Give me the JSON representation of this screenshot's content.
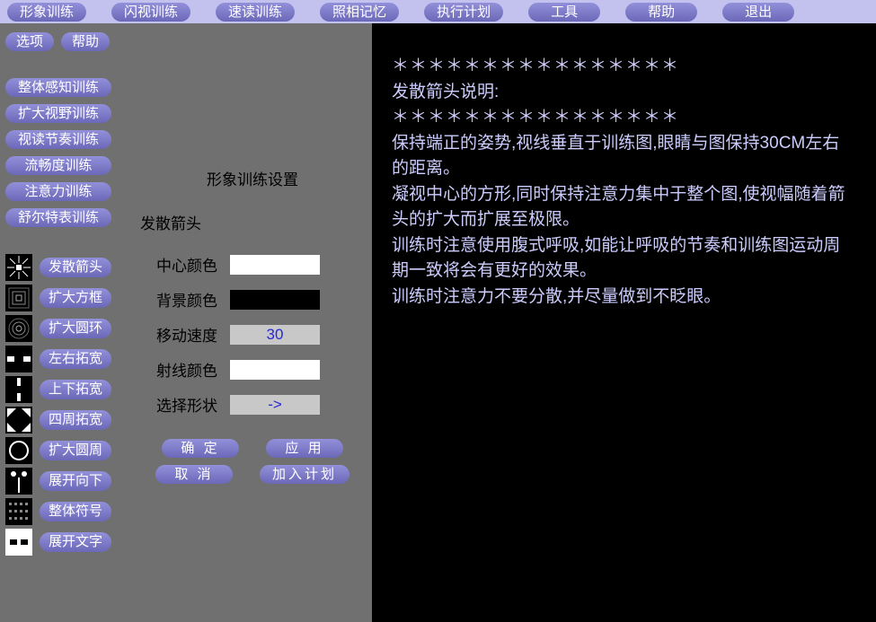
{
  "topnav": {
    "items": [
      "形象训练",
      "闪视训练",
      "速读训练",
      "照相记忆",
      "执行计划",
      "工具",
      "帮助",
      "退出"
    ]
  },
  "sidebar": {
    "top": {
      "options": "选项",
      "help": "帮助"
    },
    "categories": [
      "整体感知训练",
      "扩大视野训练",
      "视读节奏训练",
      "流畅度训练",
      "注意力训练",
      "舒尔特表训练"
    ],
    "iconItems": [
      "发散箭头",
      "扩大方框",
      "扩大圆环",
      "左右拓宽",
      "上下拓宽",
      "四周拓宽",
      "扩大圆周",
      "展开向下",
      "整体符号",
      "展开文字"
    ]
  },
  "settings": {
    "title": "形象训练设置",
    "subtitle": "发散箭头",
    "rows": {
      "centerColor": {
        "label": "中心颜色",
        "value": "#ffffff"
      },
      "bgColor": {
        "label": "背景颜色",
        "value": "#000000"
      },
      "speed": {
        "label": "移动速度",
        "value": "30"
      },
      "rayColor": {
        "label": "射线颜色",
        "value": "#ffffff"
      },
      "shape": {
        "label": "选择形状",
        "value": "->"
      }
    },
    "actions": {
      "ok": "确 定",
      "apply": "应 用",
      "cancel": "取 消",
      "addPlan": "加入计划"
    }
  },
  "desc": {
    "stars": "＊＊＊＊＊＊＊＊＊＊＊＊＊＊＊＊",
    "heading": "发散箭头说明:",
    "body": [
      "保持端正的姿势,视线垂直于训练图,眼睛与图保持30CM左右的距离。",
      "凝视中心的方形,同时保持注意力集中于整个图,使视幅随着箭头的扩大而扩展至极限。",
      "训练时注意使用腹式呼吸,如能让呼吸的节奏和训练图运动周期一致将会有更好的效果。",
      "训练时注意力不要分散,并尽量做到不眨眼。"
    ]
  }
}
